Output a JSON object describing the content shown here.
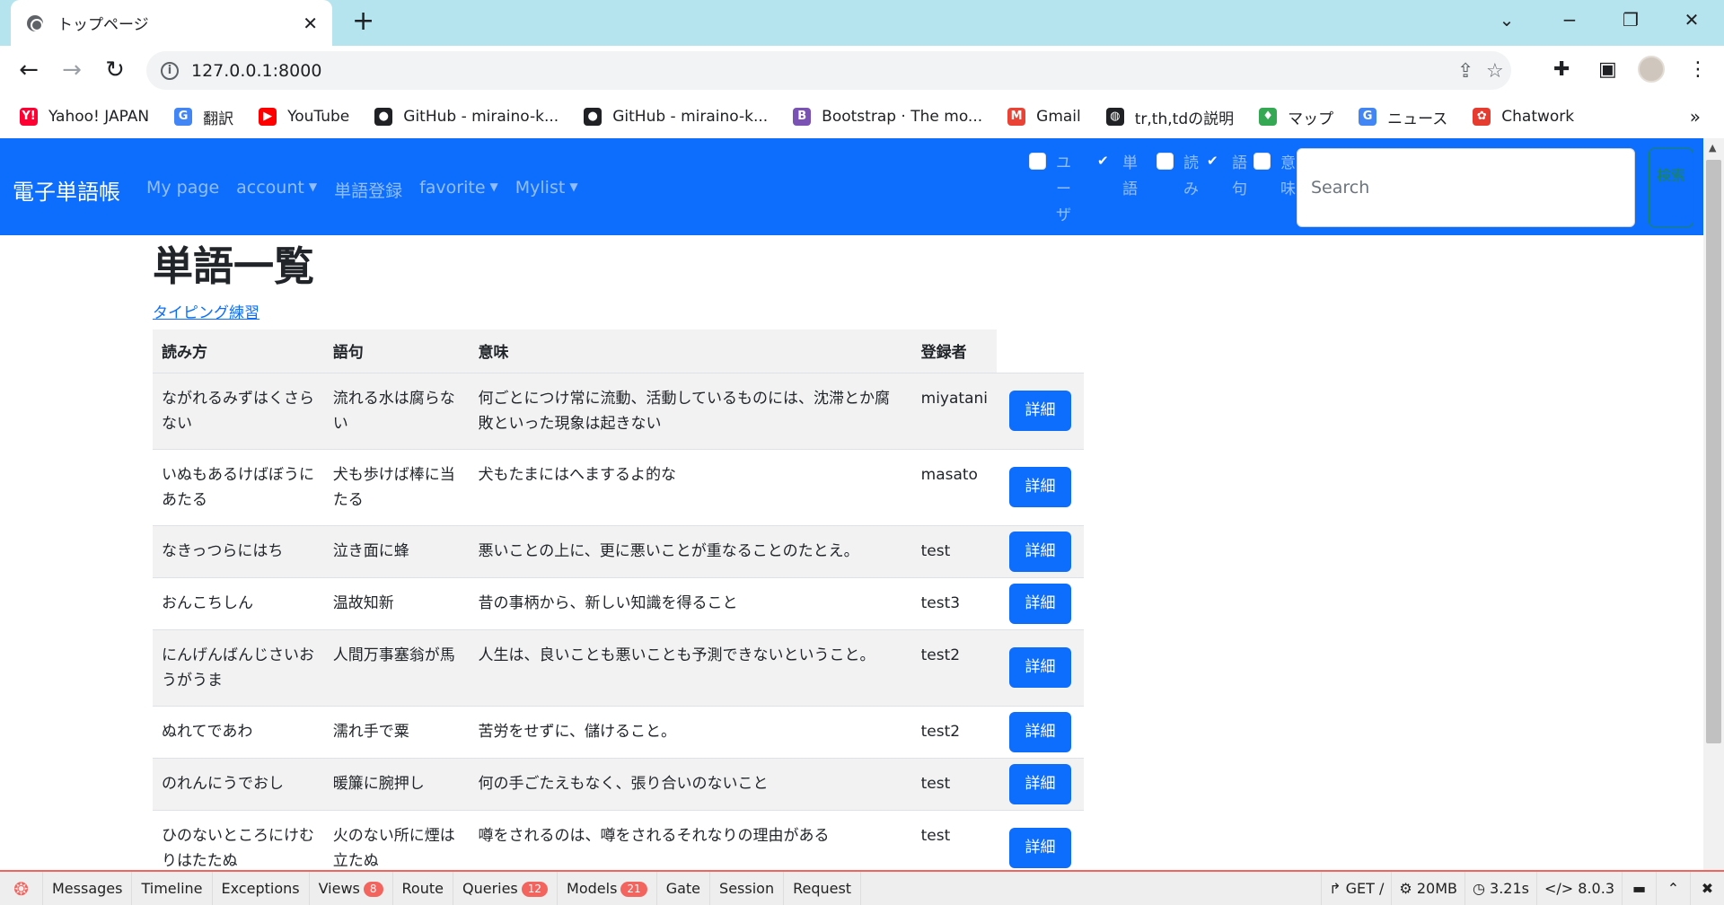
{
  "browser": {
    "tab_title": "トップページ",
    "new_tab": "+",
    "url": "127.0.0.1:8000",
    "bookmarks": [
      {
        "label": "Yahoo! JAPAN",
        "icon": "Y!",
        "color": "#ff0033"
      },
      {
        "label": "翻訳",
        "icon": "G",
        "color": "#4285f4"
      },
      {
        "label": "YouTube",
        "icon": "▶",
        "color": "#ff0000"
      },
      {
        "label": "GitHub - miraino-k...",
        "icon": "●",
        "color": "#202124"
      },
      {
        "label": "GitHub - miraino-k...",
        "icon": "●",
        "color": "#202124"
      },
      {
        "label": "Bootstrap · The mo...",
        "icon": "B",
        "color": "#7952b3"
      },
      {
        "label": "Gmail",
        "icon": "M",
        "color": "#ea4335"
      },
      {
        "label": "tr,th,tdの説明",
        "icon": "◍",
        "color": "#202124"
      },
      {
        "label": "マップ",
        "icon": "♦",
        "color": "#34a853"
      },
      {
        "label": "ニュース",
        "icon": "G",
        "color": "#4285f4"
      },
      {
        "label": "Chatwork",
        "icon": "✿",
        "color": "#e63c2f"
      }
    ]
  },
  "navbar": {
    "brand": "電子単語帳",
    "links": [
      {
        "label": "My page",
        "dropdown": false
      },
      {
        "label": "account",
        "dropdown": true
      },
      {
        "label": "単語登録",
        "dropdown": false
      },
      {
        "label": "favorite",
        "dropdown": true
      },
      {
        "label": "Mylist",
        "dropdown": true
      }
    ],
    "filters": [
      {
        "label": "ユーザー名",
        "checked": false
      },
      {
        "label": "単語",
        "checked": true
      },
      {
        "label": "読み",
        "checked": false
      },
      {
        "label": "語句",
        "checked": true
      },
      {
        "label": "意味",
        "checked": false
      }
    ],
    "search_placeholder": "Search",
    "search_button": "検索",
    "colors": {
      "navbar_bg": "#0d6efd",
      "search_button": "#198754"
    }
  },
  "main": {
    "title": "単語一覧",
    "typing_link": "タイピング練習",
    "columns": [
      "読み方",
      "語句",
      "意味",
      "登録者"
    ],
    "detail_label": "詳細",
    "rows": [
      {
        "reading": "ながれるみずはくさらない",
        "phrase": "流れる水は腐らない",
        "meaning": "何ごとにつけ常に流動、活動しているものには、沈滞とか腐敗といった現象は起きない",
        "user": "miyatani"
      },
      {
        "reading": "いぬもあるけばぼうにあたる",
        "phrase": "犬も歩けば棒に当たる",
        "meaning": "犬もたまにはへまするよ的な",
        "user": "masato"
      },
      {
        "reading": "なきっつらにはち",
        "phrase": "泣き面に蜂",
        "meaning": "悪いことの上に、更に悪いことが重なることのたとえ。",
        "user": "test"
      },
      {
        "reading": "おんこちしん",
        "phrase": "温故知新",
        "meaning": "昔の事柄から、新しい知識を得ること",
        "user": "test3"
      },
      {
        "reading": "にんげんばんじさいおうがうま",
        "phrase": "人間万事塞翁が馬",
        "meaning": "人生は、良いことも悪いことも予測できないということ。",
        "user": "test2"
      },
      {
        "reading": "ぬれてであわ",
        "phrase": "濡れ手で粟",
        "meaning": "苦労をせずに、儲けること。",
        "user": "test2"
      },
      {
        "reading": "のれんにうでおし",
        "phrase": "暖簾に腕押し",
        "meaning": "何の手ごたえもなく、張り合いのないこと",
        "user": "test"
      },
      {
        "reading": "ひのないところにけむりはたたぬ",
        "phrase": "火のない所に煙は立たぬ",
        "meaning": "噂をされるのは、噂をされるそれなりの理由がある",
        "user": "test"
      }
    ]
  },
  "debugbar": {
    "tabs": [
      {
        "label": "Messages",
        "badge": ""
      },
      {
        "label": "Timeline",
        "badge": ""
      },
      {
        "label": "Exceptions",
        "badge": ""
      },
      {
        "label": "Views",
        "badge": "8"
      },
      {
        "label": "Route",
        "badge": ""
      },
      {
        "label": "Queries",
        "badge": "12"
      },
      {
        "label": "Models",
        "badge": "21"
      },
      {
        "label": "Gate",
        "badge": ""
      },
      {
        "label": "Session",
        "badge": ""
      },
      {
        "label": "Request",
        "badge": ""
      }
    ],
    "method": "GET /",
    "memory": "20MB",
    "time": "3.21s",
    "version": "8.0.3",
    "accent": "#f4645f"
  }
}
